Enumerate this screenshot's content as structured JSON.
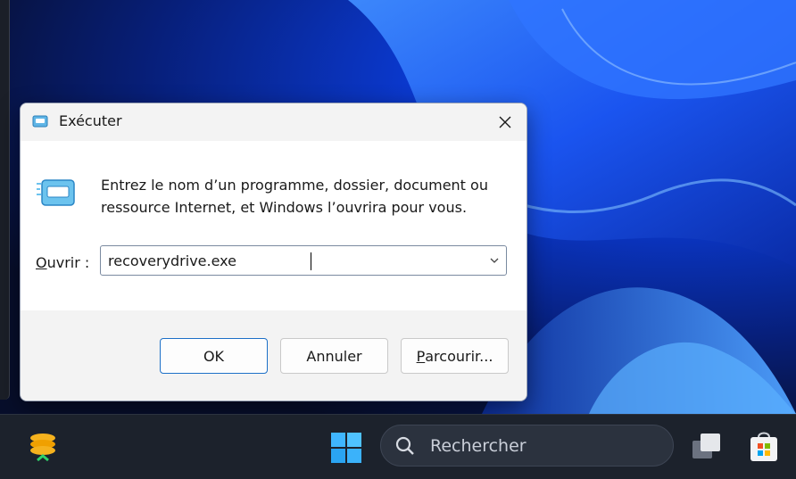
{
  "dialog": {
    "title": "Exécuter",
    "description": "Entrez le nom d’un programme, dossier, document ou ressource Internet, et Windows l’ouvrira pour vous.",
    "open_label_accel": "O",
    "open_label_rest": "uvrir :",
    "open_value": "recoverydrive.exe",
    "buttons": {
      "ok": "OK",
      "cancel": "Annuler",
      "browse_accel": "P",
      "browse_rest": "arcourir..."
    },
    "icons": {
      "title": "run-icon",
      "main": "run-icon",
      "close": "close-icon",
      "dropdown": "chevron-down-icon"
    }
  },
  "taskbar": {
    "search_placeholder": "Rechercher",
    "icons": [
      "app-coins-icon",
      "windows-start-icon",
      "search-icon",
      "task-view-icon",
      "microsoft-store-icon"
    ]
  },
  "colors": {
    "accent": "#1c6fc7",
    "taskbar": "#1c222c",
    "wallpaper": "#0b3bd6"
  }
}
